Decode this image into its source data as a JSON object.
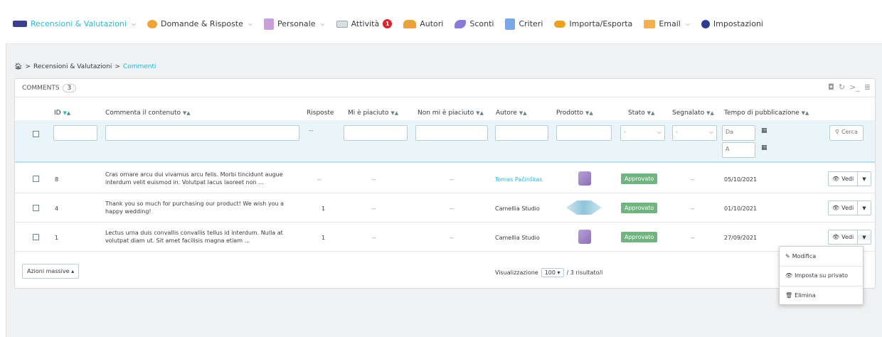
{
  "nav": [
    {
      "label": "Recensioni & Valutazioni",
      "icon": "reviews-icon",
      "chevron": true,
      "active": true
    },
    {
      "label": "Domande & Risposte",
      "icon": "qa-icon",
      "chevron": true
    },
    {
      "label": "Personale",
      "icon": "staff-icon",
      "chevron": true
    },
    {
      "label": "Attività",
      "icon": "activity-icon",
      "badge": "1"
    },
    {
      "label": "Autori",
      "icon": "authors-icon"
    },
    {
      "label": "Sconti",
      "icon": "discount-icon"
    },
    {
      "label": "Criteri",
      "icon": "criteria-icon"
    },
    {
      "label": "Importa/Esporta",
      "icon": "import-export-icon"
    },
    {
      "label": "Email",
      "icon": "email-icon",
      "chevron": true
    },
    {
      "label": "Impostazioni",
      "icon": "settings-icon"
    }
  ],
  "breadcrumb": {
    "home_icon": "home-icon",
    "sep": ">",
    "parent": "Recensioni & Valutazioni",
    "current": "Commenti"
  },
  "panel": {
    "title": "COMMENTS",
    "count": "3"
  },
  "columns": {
    "id": "ID",
    "content": "Commenta il contenuto",
    "replies": "Risposte",
    "likes": "Mi è piaciuto",
    "dislikes": "Non mi è piaciuto",
    "author": "Autore",
    "product": "Prodotto",
    "status": "Stato",
    "reported": "Segnalato",
    "time": "Tempo di pubblicazione"
  },
  "filters": {
    "replies_placeholder": "--",
    "status_value": "-",
    "reported_value": "-",
    "date_from": "Da",
    "date_to": "A",
    "search_label": "Cerca"
  },
  "rows": [
    {
      "id": "8",
      "content": "Cras ornare arcu dui vivamus arcu felis. Morbi tincidunt augue interdum velit euismod in. Volutpat lacus laoreet non ...",
      "replies": "--",
      "likes": "--",
      "dislikes": "--",
      "author": "Tomas Pačinškas",
      "author_link": true,
      "status": "Approvato",
      "reported": "--",
      "time": "05/10/2021",
      "view": "Vedi"
    },
    {
      "id": "4",
      "content": "Thank you so much for purchasing our product! We wish you a happy wedding!",
      "replies": "1",
      "likes": "--",
      "dislikes": "--",
      "author": "Camellia Studio",
      "author_link": false,
      "status": "Approvato",
      "reported": "--",
      "time": "01/10/2021",
      "view": "Vedi"
    },
    {
      "id": "1",
      "content": "Lectus urna duis convallis convallis tellus id interdum. Nulla at volutpat diam ut. Sit amet facilisis magna etiam ...",
      "replies": "1",
      "likes": "--",
      "dislikes": "--",
      "author": "Camellia Studio",
      "author_link": false,
      "status": "Approvato",
      "reported": "--",
      "time": "27/09/2021",
      "view": "Vedi"
    }
  ],
  "footer": {
    "bulk": "Azioni massive",
    "display_label": "Visualizzazione",
    "per_page": "100",
    "results": "/ 3 risultato/i"
  },
  "dropdown": {
    "edit": "Modifica",
    "private": "Imposta su privato",
    "delete": "Elimina"
  },
  "colors": {
    "accent": "#25b9d7",
    "approved": "#70b580",
    "badge": "#e0202a"
  }
}
